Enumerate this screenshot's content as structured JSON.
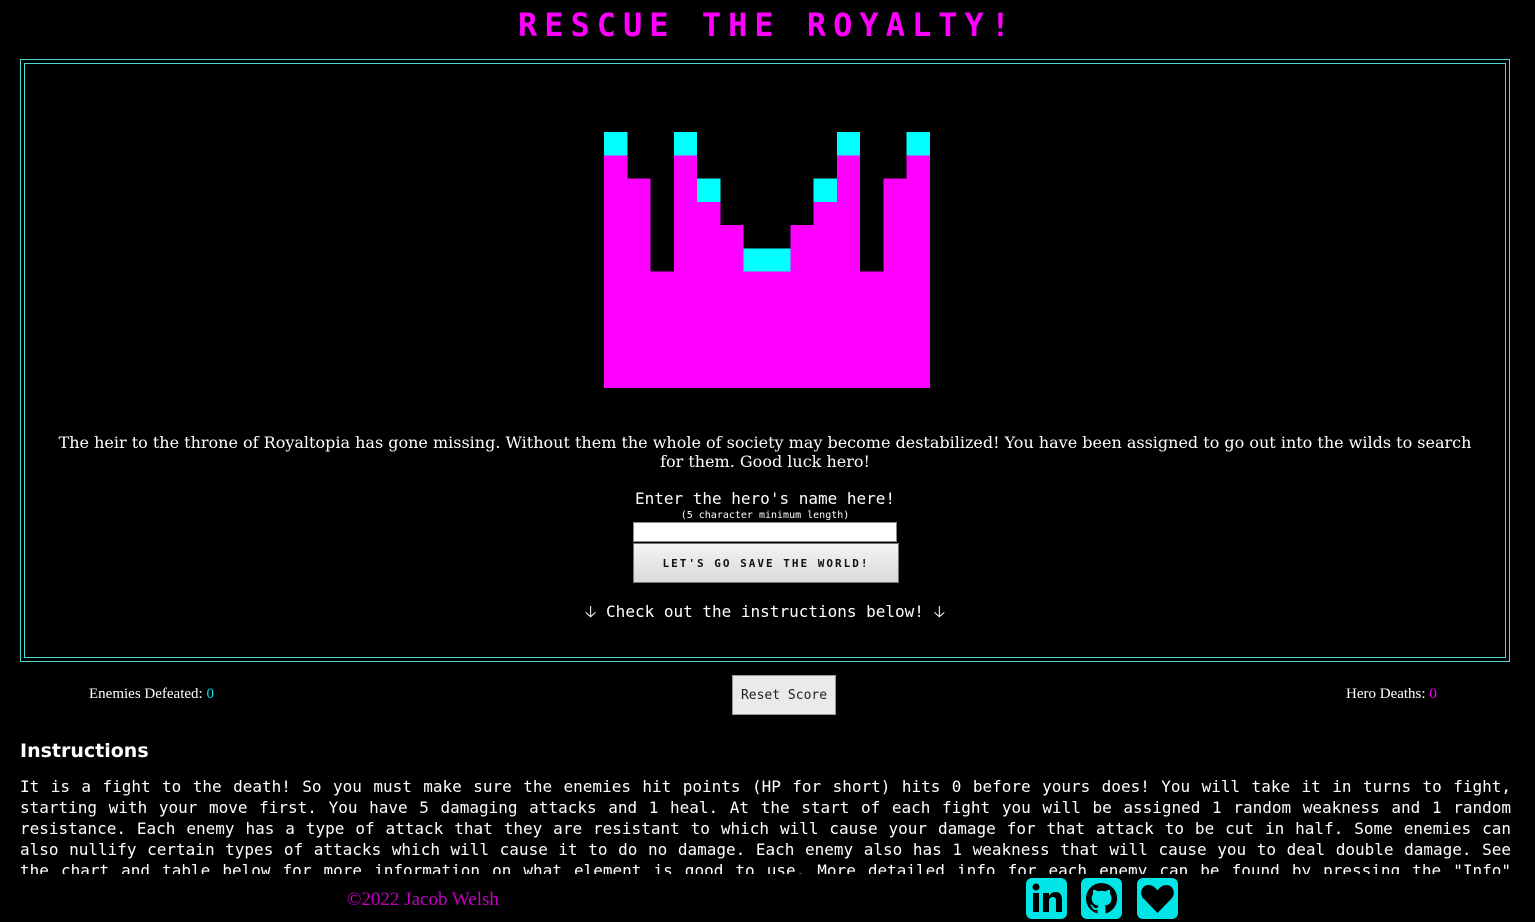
{
  "title": "RESCUE THE ROYALTY!",
  "colors": {
    "magenta": "#ff00ff",
    "cyan": "#00ffff",
    "frame_border": "#4fd8d8"
  },
  "game": {
    "intro_text": "The heir to the throne of Royaltopia has gone missing. Without them the whole of society may become destabilized! You have been assigned to go out into the wilds to search for them. Good luck hero!",
    "name_label": "Enter the hero's name here!",
    "name_hint": "(5 character minimum length)",
    "name_value": "",
    "start_button_label": "LET'S GO SAVE THE WORLD!",
    "instructions_hint": "Check out the instructions below!"
  },
  "score": {
    "enemies_label": "Enemies Defeated:",
    "enemies_value": "0",
    "reset_label": "Reset Score",
    "deaths_label": "Hero Deaths:",
    "deaths_value": "0"
  },
  "instructions": {
    "heading": "Instructions",
    "body": "It is a fight to the death! So you must make sure the enemies hit points (HP for short) hits 0 before yours does! You will take it in turns to fight, starting with your move first. You have 5 damaging attacks and 1 heal. At the start of each fight you will be assigned 1 random weakness and 1 random resistance. Each enemy has a type of attack that they are resistant to which will cause your damage for that attack to be cut in half. Some enemies can also nullify certain types of attacks which will cause it to do no damage. Each enemy also has 1 weakness that will cause you to deal double damage. See the chart and table below for more information on what element is good to use. More detailed info for each enemy can be found by pressing the \"Info\" button"
  },
  "footer": {
    "copyright": "©2022 Jacob Welsh",
    "social": [
      "linkedin-icon",
      "github-icon",
      "heart-icon"
    ]
  }
}
